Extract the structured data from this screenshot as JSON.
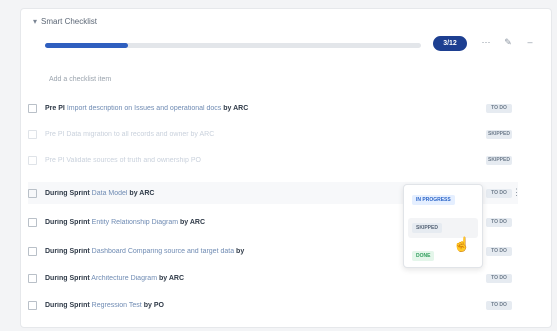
{
  "header": {
    "title": "Smart Checklist",
    "progress_label": "3/12",
    "progress_fraction": 0.22
  },
  "add_placeholder": "Add a checklist item",
  "header_icons": [
    "more-icon",
    "edit-icon",
    "collapse-icon"
  ],
  "items": [
    {
      "phase": "Pre PI",
      "text": "Import description on Issues and operational docs",
      "by": "by ARC",
      "status": "TO DO",
      "dim": false
    },
    {
      "phase": "Pre PI",
      "text": "Data migration to all records and owner",
      "by": "by ARC",
      "status": "SKIPPED",
      "dim": true
    },
    {
      "phase": "Pre PI",
      "text": "Validate sources of truth and ownership",
      "by": "PO",
      "status": "SKIPPED",
      "dim": true
    },
    {
      "phase": "During Sprint",
      "text": "Data Model",
      "by": "by ARC",
      "status": "TO DO",
      "dim": false,
      "hover": true
    },
    {
      "phase": "During Sprint",
      "text": "Entity Relationship Diagram",
      "by": "by ARC",
      "status": "TO DO",
      "dim": false
    },
    {
      "phase": "During Sprint",
      "text": "Dashboard Comparing source and target data",
      "by": "by",
      "status": "TO DO",
      "dim": false
    },
    {
      "phase": "During Sprint",
      "text": "Architecture Diagram",
      "by": "by ARC",
      "status": "TO DO",
      "dim": false
    },
    {
      "phase": "During Sprint",
      "text": "Regression Test",
      "by": "by PO",
      "status": "TO DO",
      "dim": false
    }
  ],
  "dropdown": {
    "in_progress": "IN PROGRESS",
    "skipped": "SKIPPED",
    "done": "DONE"
  }
}
